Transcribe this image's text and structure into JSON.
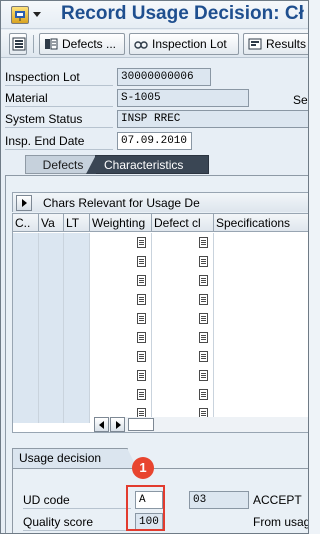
{
  "window": {
    "title": "Record Usage Decision: Cł"
  },
  "toolbar": {
    "defects_label": "Defects ...",
    "inspection_lot_label": "Inspection Lot",
    "results_label": "Results"
  },
  "header": {
    "inspection_lot": {
      "label": "Inspection Lot",
      "value": "30000000006"
    },
    "material": {
      "label": "Material",
      "value": "S-1005",
      "right_label": "Se"
    },
    "system_status": {
      "label": "System Status",
      "value": "INSP RREC"
    },
    "insp_end_date": {
      "label": "Insp. End Date",
      "value": "07.09.2010"
    }
  },
  "tabs": [
    {
      "label": "Defects",
      "active": false
    },
    {
      "label": "Characteristics",
      "active": true
    }
  ],
  "characteristics": {
    "section_title": "Chars Relevant for Usage De",
    "columns": [
      "C..",
      "Va",
      "LT",
      "Weighting",
      "Defect cl",
      "Specifications"
    ],
    "row_count": 10
  },
  "usage_decision": {
    "section_label": "Usage decision",
    "ud_code_label": "UD code",
    "ud_code_value": "A",
    "ud_code_num": "03",
    "ud_code_text": "ACCEPT",
    "quality_score_label": "Quality score",
    "quality_score_value": "100",
    "quality_score_text": "From usag"
  },
  "annotation": {
    "marker_label": "1",
    "highlight_color": "#e23b2e"
  },
  "colors": {
    "title": "#1f4f8f",
    "active_tab": "#3a4654",
    "field_bg": "#dce6f0"
  }
}
